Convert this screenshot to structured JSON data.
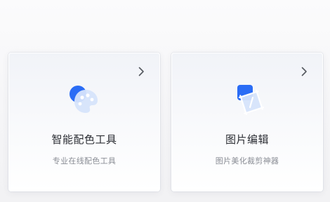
{
  "cards": [
    {
      "title": "智能配色工具",
      "description": "专业在线配色工具",
      "icon": "palette-icon"
    },
    {
      "title": "图片编辑",
      "description": "图片美化裁剪神器",
      "icon": "image-edit-icon"
    }
  ],
  "colors": {
    "accent": "#2a6cf5",
    "icon_light": "#cfe0fb",
    "chevron": "#55585f"
  }
}
